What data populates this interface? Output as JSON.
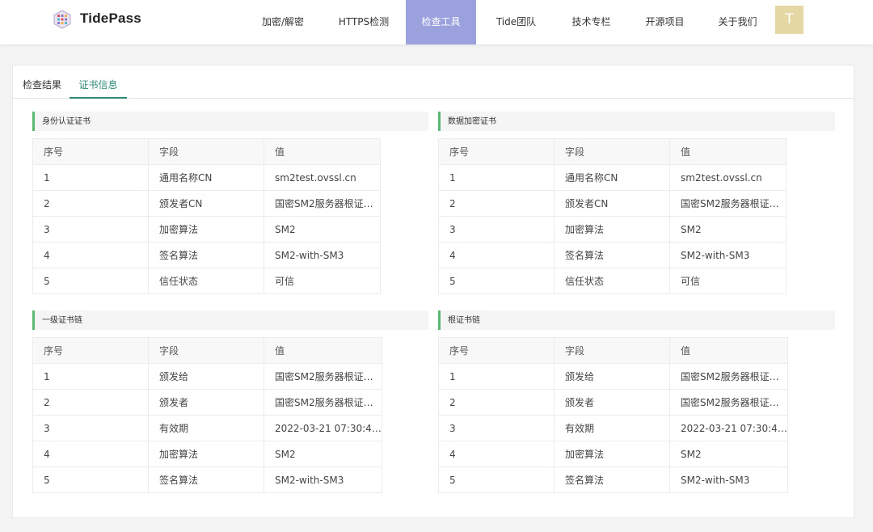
{
  "header": {
    "brand": "TidePass",
    "nav": [
      {
        "label": "加密/解密",
        "active": false
      },
      {
        "label": "HTTPS检测",
        "active": false
      },
      {
        "label": "检查工具",
        "active": true
      },
      {
        "label": "Tide团队",
        "active": false
      },
      {
        "label": "技术专栏",
        "active": false
      },
      {
        "label": "开源项目",
        "active": false
      },
      {
        "label": "关于我们",
        "active": false
      }
    ],
    "avatar": "T"
  },
  "tabs": [
    {
      "label": "检查结果",
      "active": false
    },
    {
      "label": "证书信息",
      "active": true
    }
  ],
  "colors": {
    "accent": "#2f8a74",
    "nav_active": "#9aa1dc",
    "section_bar": "#5cb870",
    "avatar": "#e6d8a4"
  },
  "sections": [
    {
      "title": "身份认证证书",
      "columns": [
        "序号",
        "字段",
        "值"
      ],
      "rows": [
        [
          "1",
          "通用名称CN",
          "sm2test.ovssl.cn"
        ],
        [
          "2",
          "颁发者CN",
          "国密SM2服务器根证…"
        ],
        [
          "3",
          "加密算法",
          "SM2"
        ],
        [
          "4",
          "签名算法",
          "SM2-with-SM3"
        ],
        [
          "5",
          "信任状态",
          "可信"
        ]
      ]
    },
    {
      "title": "数据加密证书",
      "columns": [
        "序号",
        "字段",
        "值"
      ],
      "rows": [
        [
          "1",
          "通用名称CN",
          "sm2test.ovssl.cn"
        ],
        [
          "2",
          "颁发者CN",
          "国密SM2服务器根证…"
        ],
        [
          "3",
          "加密算法",
          "SM2"
        ],
        [
          "4",
          "签名算法",
          "SM2-with-SM3"
        ],
        [
          "5",
          "信任状态",
          "可信"
        ]
      ]
    },
    {
      "title": "一级证书链",
      "columns": [
        "序号",
        "字段",
        "值"
      ],
      "rows": [
        [
          "1",
          "颁发给",
          "国密SM2服务器根证…"
        ],
        [
          "2",
          "颁发者",
          "国密SM2服务器根证…"
        ],
        [
          "3",
          "有效期",
          "2022-03-21 07:30:4…"
        ],
        [
          "4",
          "加密算法",
          "SM2"
        ],
        [
          "5",
          "签名算法",
          "SM2-with-SM3"
        ]
      ]
    },
    {
      "title": "根证书链",
      "columns": [
        "序号",
        "字段",
        "值"
      ],
      "rows": [
        [
          "1",
          "颁发给",
          "国密SM2服务器根证…"
        ],
        [
          "2",
          "颁发者",
          "国密SM2服务器根证…"
        ],
        [
          "3",
          "有效期",
          "2022-03-21 07:30:4…"
        ],
        [
          "4",
          "加密算法",
          "SM2"
        ],
        [
          "5",
          "签名算法",
          "SM2-with-SM3"
        ]
      ]
    }
  ]
}
